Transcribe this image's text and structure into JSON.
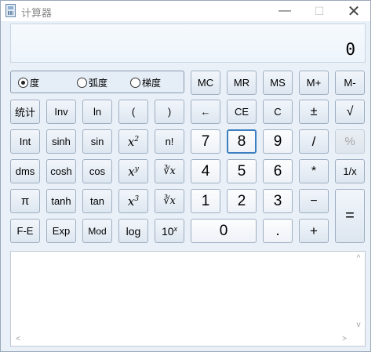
{
  "window": {
    "title": "计算器",
    "min": "—",
    "max": "☐",
    "close": "✕"
  },
  "display": {
    "value": "0"
  },
  "angle_units": [
    {
      "label": "度",
      "selected": true
    },
    {
      "label": "弧度",
      "selected": false
    },
    {
      "label": "梯度",
      "selected": false
    }
  ],
  "memory": {
    "mc": "MC",
    "mr": "MR",
    "ms": "MS",
    "mplus": "M+",
    "mminus": "M-"
  },
  "sci": {
    "stat": "统计",
    "inv": "Inv",
    "ln": "ln",
    "lparen": "(",
    "rparen": ")",
    "int": "Int",
    "sinh": "sinh",
    "sin": "sin",
    "x2_base": "x",
    "x2_exp": "2",
    "fact": "n!",
    "dms": "dms",
    "cosh": "cosh",
    "cos": "cos",
    "xy_base": "x",
    "xy_exp": "y",
    "yroot": "∛x",
    "pi": "π",
    "tanh": "tanh",
    "tan": "tan",
    "x3_base": "x",
    "x3_exp": "3",
    "cbrt": "∛x",
    "fe": "F-E",
    "exp": "Exp",
    "mod": "Mod",
    "log": "log",
    "tenx_base": "10",
    "tenx_exp": "x"
  },
  "std": {
    "back": "←",
    "ce": "CE",
    "c": "C",
    "neg": "±",
    "sqrt": "√",
    "d7": "7",
    "d8": "8",
    "d9": "9",
    "div": "/",
    "pct": "%",
    "d4": "4",
    "d5": "5",
    "d6": "6",
    "mul": "*",
    "recip": "1/x",
    "d1": "1",
    "d2": "2",
    "d3": "3",
    "sub": "−",
    "eq": "=",
    "d0": "0",
    "dot": ".",
    "add": "+"
  },
  "history": {
    "up": "^",
    "down": "v",
    "left": "<",
    "right": ">"
  }
}
